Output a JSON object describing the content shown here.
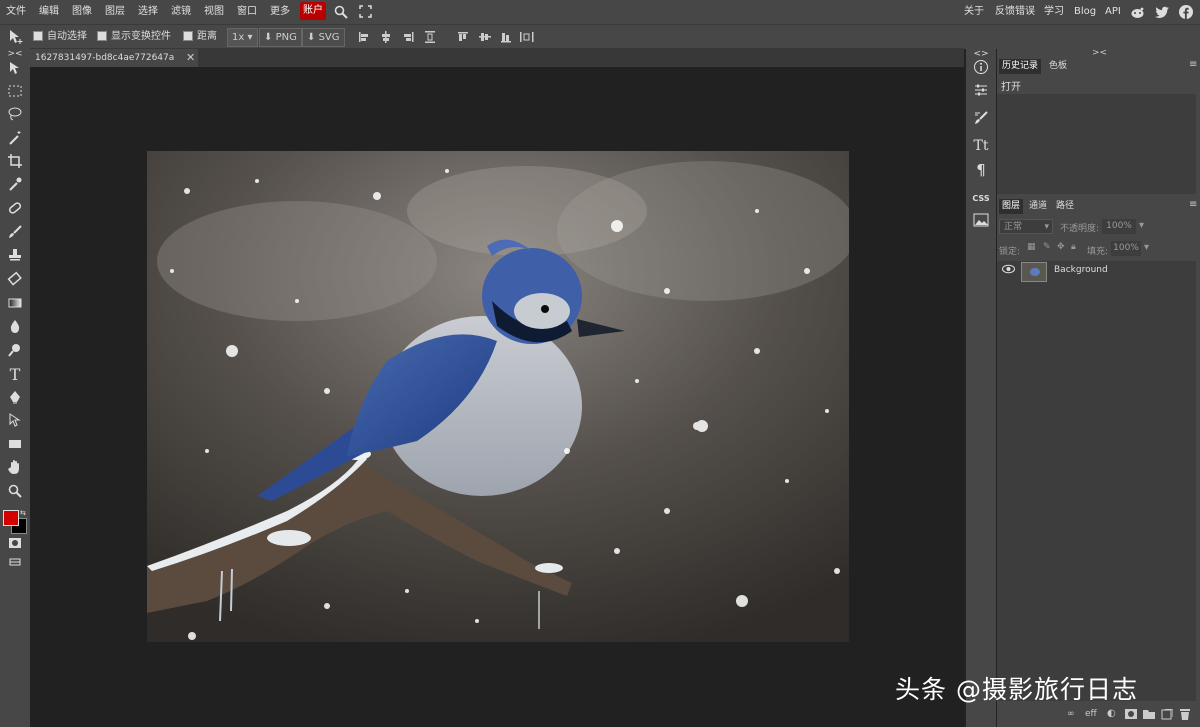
{
  "menu": {
    "items": [
      "文件",
      "编辑",
      "图像",
      "图层",
      "选择",
      "滤镜",
      "视图",
      "窗口",
      "更多"
    ],
    "account_label": "账户",
    "right_links": [
      "关于",
      "反馈错误",
      "学习",
      "Blog",
      "API"
    ]
  },
  "toolbar": {
    "auto_select_label": "自动选择",
    "show_transform_label": "显示变换控件",
    "distance_label": "距离",
    "zoom_value": "1x",
    "export_png_label": "PNG",
    "export_svg_label": "SVG"
  },
  "document": {
    "tab_title": "1627831497-bd8c4ae772647a",
    "tab_close": "✕"
  },
  "history_panel": {
    "tabs": [
      "历史记录",
      "色板"
    ],
    "entries": [
      "打开"
    ]
  },
  "layers_panel": {
    "tabs": [
      "图层",
      "通道",
      "路径"
    ],
    "blend_mode": "正常",
    "opacity_label": "不透明度:",
    "opacity_value": "100%",
    "lock_label": "锁定:",
    "fill_label": "填充:",
    "fill_value": "100%",
    "layers": [
      {
        "name": "Background",
        "visible": true
      }
    ]
  },
  "colors": {
    "foreground": "#d40000",
    "background": "#000000",
    "accent_menu": "#b80000"
  },
  "watermark": "头条 @摄影旅行日志"
}
